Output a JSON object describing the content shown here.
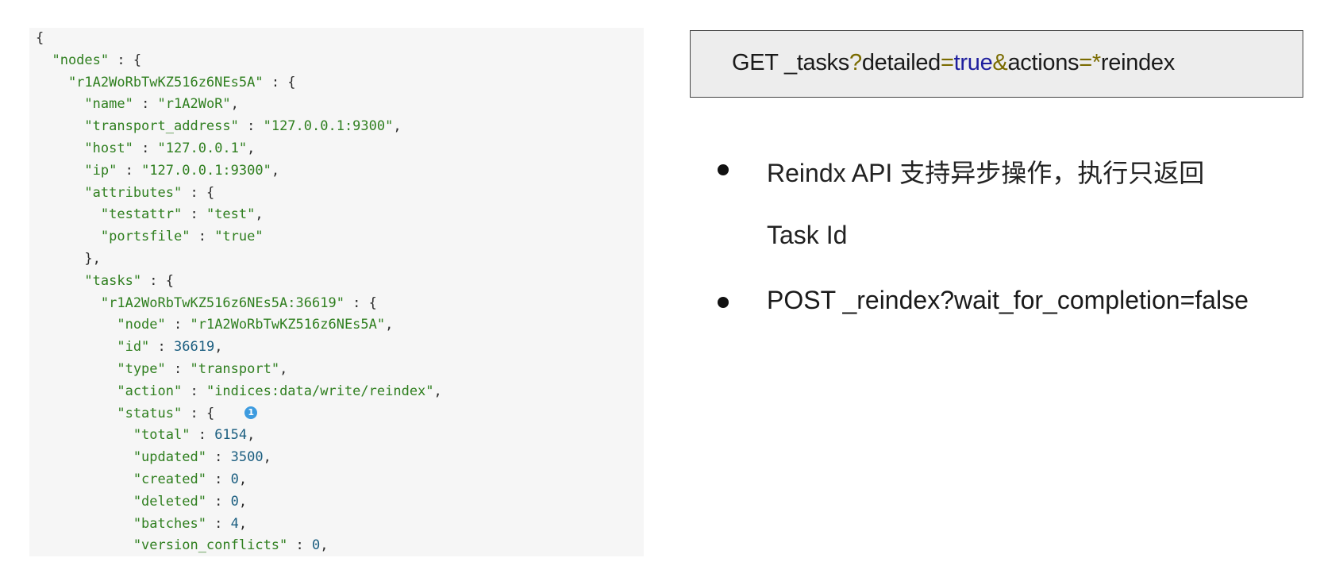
{
  "code": {
    "lines": [
      [
        {
          "t": "{",
          "c": "p"
        }
      ],
      [
        {
          "t": "  \"nodes\"",
          "c": "k"
        },
        {
          "t": " : {",
          "c": "p"
        }
      ],
      [
        {
          "t": "    \"r1A2WoRbTwKZ516z6NEs5A\"",
          "c": "k"
        },
        {
          "t": " : {",
          "c": "p"
        }
      ],
      [
        {
          "t": "      \"name\"",
          "c": "k"
        },
        {
          "t": " : ",
          "c": "p"
        },
        {
          "t": "\"r1A2WoR\"",
          "c": "s"
        },
        {
          "t": ",",
          "c": "p"
        }
      ],
      [
        {
          "t": "      \"transport_address\"",
          "c": "k"
        },
        {
          "t": " : ",
          "c": "p"
        },
        {
          "t": "\"127.0.0.1:9300\"",
          "c": "s"
        },
        {
          "t": ",",
          "c": "p"
        }
      ],
      [
        {
          "t": "      \"host\"",
          "c": "k"
        },
        {
          "t": " : ",
          "c": "p"
        },
        {
          "t": "\"127.0.0.1\"",
          "c": "s"
        },
        {
          "t": ",",
          "c": "p"
        }
      ],
      [
        {
          "t": "      \"ip\"",
          "c": "k"
        },
        {
          "t": " : ",
          "c": "p"
        },
        {
          "t": "\"127.0.0.1:9300\"",
          "c": "s"
        },
        {
          "t": ",",
          "c": "p"
        }
      ],
      [
        {
          "t": "      \"attributes\"",
          "c": "k"
        },
        {
          "t": " : {",
          "c": "p"
        }
      ],
      [
        {
          "t": "        \"testattr\"",
          "c": "k"
        },
        {
          "t": " : ",
          "c": "p"
        },
        {
          "t": "\"test\"",
          "c": "s"
        },
        {
          "t": ",",
          "c": "p"
        }
      ],
      [
        {
          "t": "        \"portsfile\"",
          "c": "k"
        },
        {
          "t": " : ",
          "c": "p"
        },
        {
          "t": "\"true\"",
          "c": "s"
        }
      ],
      [
        {
          "t": "      },",
          "c": "p"
        }
      ],
      [
        {
          "t": "      \"tasks\"",
          "c": "k"
        },
        {
          "t": " : {",
          "c": "p"
        }
      ],
      [
        {
          "t": "        \"r1A2WoRbTwKZ516z6NEs5A:36619\"",
          "c": "k"
        },
        {
          "t": " : {",
          "c": "p"
        }
      ],
      [
        {
          "t": "          \"node\"",
          "c": "k"
        },
        {
          "t": " : ",
          "c": "p"
        },
        {
          "t": "\"r1A2WoRbTwKZ516z6NEs5A\"",
          "c": "s"
        },
        {
          "t": ",",
          "c": "p"
        }
      ],
      [
        {
          "t": "          \"id\"",
          "c": "k"
        },
        {
          "t": " : ",
          "c": "p"
        },
        {
          "t": "36619",
          "c": "n"
        },
        {
          "t": ",",
          "c": "p"
        }
      ],
      [
        {
          "t": "          \"type\"",
          "c": "k"
        },
        {
          "t": " : ",
          "c": "p"
        },
        {
          "t": "\"transport\"",
          "c": "s"
        },
        {
          "t": ",",
          "c": "p"
        }
      ],
      [
        {
          "t": "          \"action\"",
          "c": "k"
        },
        {
          "t": " : ",
          "c": "p"
        },
        {
          "t": "\"indices:data/write/reindex\"",
          "c": "s"
        },
        {
          "t": ",",
          "c": "p"
        }
      ],
      [
        {
          "t": "          \"status\"",
          "c": "k"
        },
        {
          "t": " : {",
          "c": "p"
        }
      ],
      [
        {
          "t": "            \"total\"",
          "c": "k"
        },
        {
          "t": " : ",
          "c": "p"
        },
        {
          "t": "6154",
          "c": "n"
        },
        {
          "t": ",",
          "c": "p"
        }
      ],
      [
        {
          "t": "            \"updated\"",
          "c": "k"
        },
        {
          "t": " : ",
          "c": "p"
        },
        {
          "t": "3500",
          "c": "n"
        },
        {
          "t": ",",
          "c": "p"
        }
      ],
      [
        {
          "t": "            \"created\"",
          "c": "k"
        },
        {
          "t": " : ",
          "c": "p"
        },
        {
          "t": "0",
          "c": "n"
        },
        {
          "t": ",",
          "c": "p"
        }
      ],
      [
        {
          "t": "            \"deleted\"",
          "c": "k"
        },
        {
          "t": " : ",
          "c": "p"
        },
        {
          "t": "0",
          "c": "n"
        },
        {
          "t": ",",
          "c": "p"
        }
      ],
      [
        {
          "t": "            \"batches\"",
          "c": "k"
        },
        {
          "t": " : ",
          "c": "p"
        },
        {
          "t": "4",
          "c": "n"
        },
        {
          "t": ",",
          "c": "p"
        }
      ],
      [
        {
          "t": "            \"version_conflicts\"",
          "c": "k"
        },
        {
          "t": " : ",
          "c": "p"
        },
        {
          "t": "0",
          "c": "n"
        },
        {
          "t": ",",
          "c": "p"
        }
      ]
    ],
    "callout_label": "1"
  },
  "request": {
    "method": "GET _tasks",
    "q": "?",
    "param1": "detailed",
    "eq1": "=",
    "val1": "true",
    "amp": "&",
    "param2": "actions",
    "eq2": "=",
    "star": "*",
    "val2": "reindex"
  },
  "bullets": {
    "first_line1": "Reindx API 支持异步操作，执行只返回",
    "first_line2": "Task Id",
    "second": "POST _reindex?wait_for_completion=false"
  }
}
